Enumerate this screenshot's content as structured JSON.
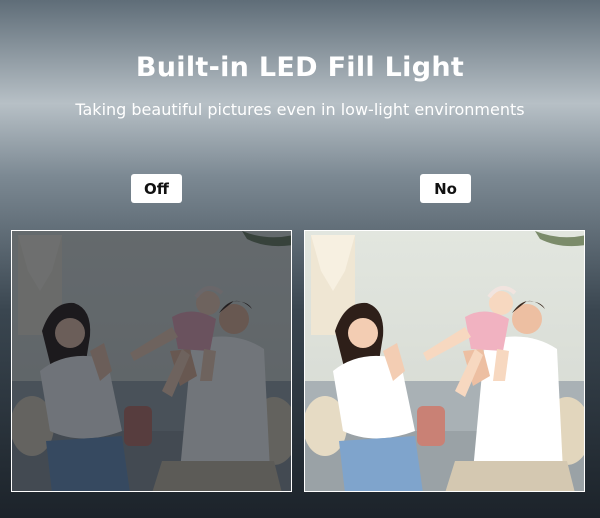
{
  "header": {
    "title": "Built-in LED Fill Light",
    "subtitle": "Taking beautiful pictures even in low-light environments"
  },
  "comparison": {
    "left_label": "Off",
    "right_label": "No"
  },
  "colors": {
    "badge_bg": "#ffffff",
    "badge_text": "#111111",
    "heading_text": "#ffffff",
    "photo_border": "#ffffff"
  }
}
